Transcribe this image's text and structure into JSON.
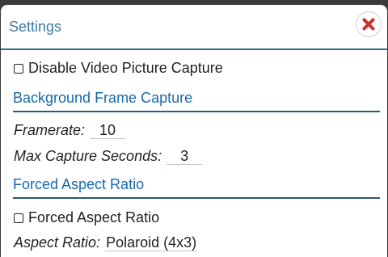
{
  "dialog": {
    "title": "Settings",
    "close_icon": "close-x-icon"
  },
  "disable_video": {
    "label": "Disable Video Picture Capture",
    "checked": false
  },
  "background_section": {
    "title": "Background Frame Capture",
    "framerate_label": "Framerate:",
    "framerate_value": "10",
    "max_seconds_label": "Max Capture Seconds:",
    "max_seconds_value": "3"
  },
  "aspect_section": {
    "title": "Forced Aspect Ratio",
    "checkbox_label": "Forced Aspect Ratio",
    "checked": false,
    "ratio_label": "Aspect Ratio:",
    "ratio_value": "Polaroid (4x3)"
  },
  "colors": {
    "accent": "#1769aa",
    "title": "#3d79a5",
    "close": "#c9302c"
  }
}
